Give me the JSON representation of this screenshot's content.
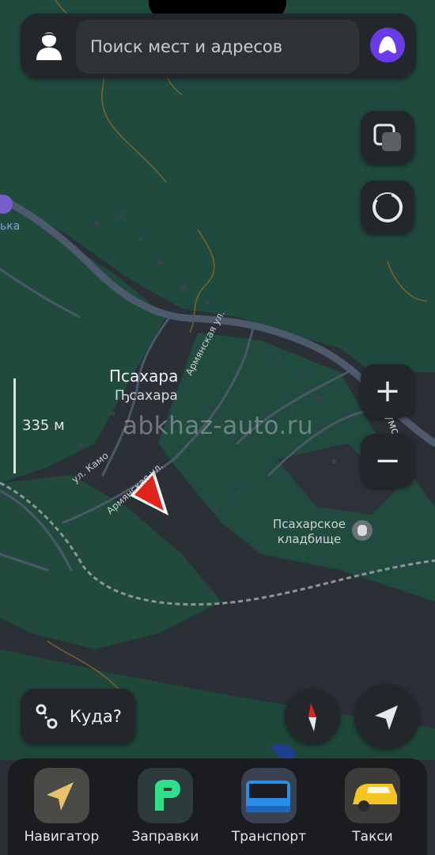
{
  "search": {
    "placeholder": "Поиск мест и адресов",
    "avatar_icon": "user-silhouette-icon",
    "assistant_icon": "alice-icon"
  },
  "map": {
    "place_name": "Псахара",
    "place_name_alt": "Ҧсахара",
    "streets": [
      "Армянская ул.",
      "ул. Камо",
      "Армянская ул."
    ],
    "cemetery": "Псахарское\nкладбище",
    "scale": "335 м",
    "partial_left_label": "ька",
    "partial_right_label": "ухумско",
    "watermark": "abkhaz-auto.ru",
    "colors": {
      "forest": "#1f4a3d",
      "land": "#2b2f36",
      "road": "#4a5668",
      "route_line": "#8fa0b8"
    }
  },
  "controls": {
    "layers_icon": "layers-icon",
    "panorama_icon": "panorama-icon",
    "zoom_in": "+",
    "zoom_out": "−",
    "compass_icon": "compass-icon",
    "locate_icon": "locate-arrow-icon"
  },
  "where": {
    "label": "Куда?",
    "icon": "route-icon"
  },
  "apps": [
    {
      "label": "Навигатор",
      "icon": "navigator-icon"
    },
    {
      "label": "Заправки",
      "icon": "fuel-icon"
    },
    {
      "label": "Транспорт",
      "icon": "bus-icon"
    },
    {
      "label": "Такси",
      "icon": "taxi-icon"
    }
  ]
}
